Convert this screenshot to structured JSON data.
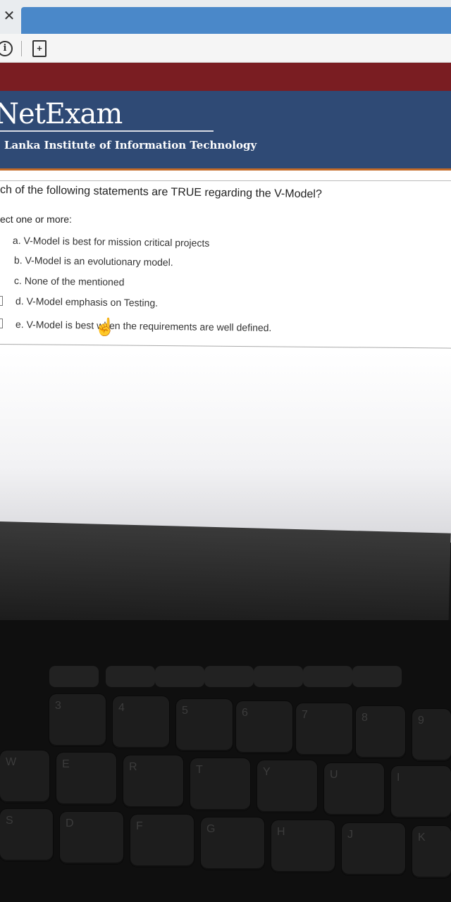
{
  "browser": {
    "close_glyph": "✕",
    "info_glyph": "i",
    "page_glyph": "+"
  },
  "header": {
    "brand": "NetExam",
    "institute": "Lanka Institute of Information Technology"
  },
  "quiz": {
    "question": "ch of the following statements are TRUE regarding the V-Model?",
    "select_prompt": "ect one or more:",
    "options": [
      "a. V-Model is best for mission critical projects",
      "b. V-Model is an evolutionary model.",
      "c. None of the mentioned",
      "d. V-Model emphasis on Testing.",
      "e. V-Model is best when the requirements are well defined."
    ]
  },
  "keyboard": {
    "row1": [
      "3",
      "4",
      "5",
      "6",
      "7",
      "8",
      "9"
    ],
    "row2": [
      "W",
      "E",
      "R",
      "T",
      "Y",
      "U",
      "I"
    ],
    "row3": [
      "S",
      "D",
      "F",
      "G",
      "H",
      "J",
      "K"
    ]
  },
  "colors": {
    "header_bg": "#2f4a75",
    "accent_red": "#7a1d22",
    "accent_orange": "#c46b28",
    "tab_blue": "#4a88c9"
  }
}
